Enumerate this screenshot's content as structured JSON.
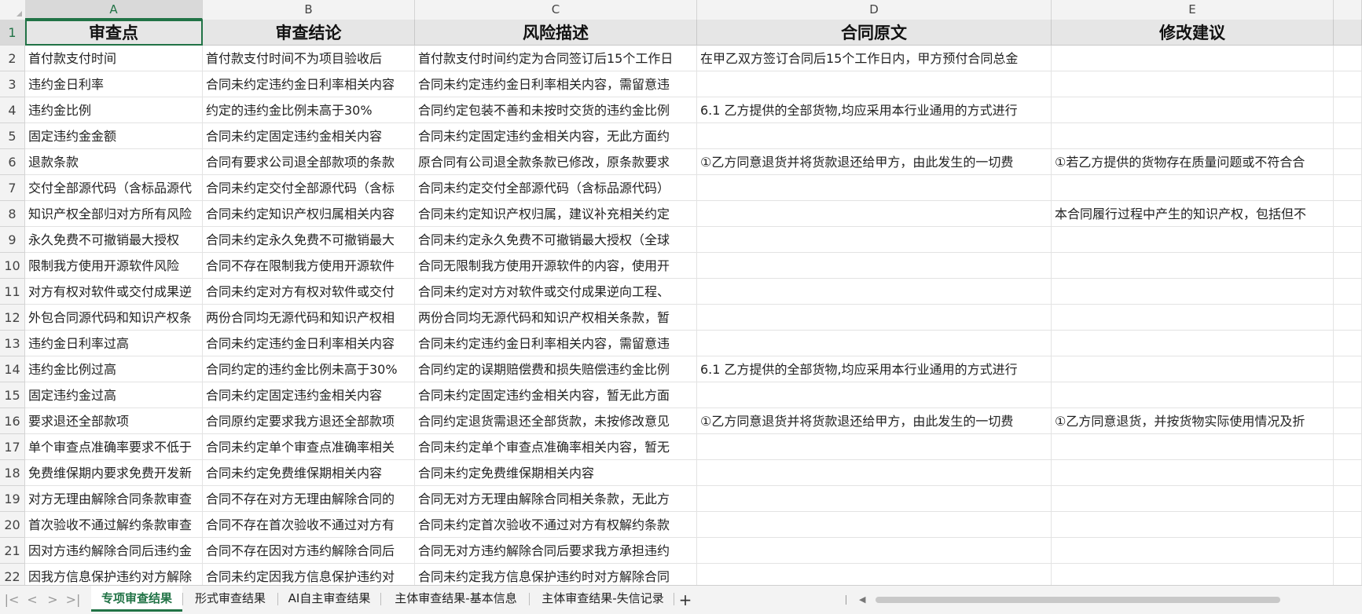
{
  "columns": [
    "A",
    "B",
    "C",
    "D",
    "E"
  ],
  "headers": [
    "审查点",
    "审查结论",
    "风险描述",
    "合同原文",
    "修改建议"
  ],
  "rows": [
    {
      "num": "2",
      "cells": [
        "首付款支付时间",
        "首付款支付时间不为项目验收后",
        "首付款支付时间约定为合同签订后15个工作日",
        "在甲乙双方签订合同后15个工作日内，甲方预付合同总金",
        ""
      ]
    },
    {
      "num": "3",
      "cells": [
        "违约金日利率",
        "合同未约定违约金日利率相关内容",
        "合同未约定违约金日利率相关内容，需留意违",
        "",
        ""
      ]
    },
    {
      "num": "4",
      "cells": [
        "违约金比例",
        "约定的违约金比例未高于30%",
        "合同约定包装不善和未按时交货的违约金比例",
        "6.1    乙方提供的全部货物,均应采用本行业通用的方式进行",
        ""
      ]
    },
    {
      "num": "5",
      "cells": [
        "固定违约金金额",
        "合同未约定固定违约金相关内容",
        "合同未约定固定违约金相关内容，无此方面约",
        "",
        ""
      ]
    },
    {
      "num": "6",
      "cells": [
        "退款条款",
        "合同有要求公司退全部款项的条款",
        "原合同有公司退全款条款已修改，原条款要求",
        "①乙方同意退货并将货款退还给甲方，由此发生的一切费",
        "①若乙方提供的货物存在质量问题或不符合合"
      ]
    },
    {
      "num": "7",
      "cells": [
        "交付全部源代码（含标品源代",
        "合同未约定交付全部源代码（含标",
        "合同未约定交付全部源代码（含标品源代码）",
        "",
        ""
      ]
    },
    {
      "num": "8",
      "cells": [
        "知识产权全部归对方所有风险",
        "合同未约定知识产权归属相关内容",
        "合同未约定知识产权归属，建议补充相关约定",
        "",
        "本合同履行过程中产生的知识产权，包括但不"
      ]
    },
    {
      "num": "9",
      "cells": [
        "永久免费不可撤销最大授权",
        "合同未约定永久免费不可撤销最大",
        "合同未约定永久免费不可撤销最大授权（全球",
        "",
        ""
      ]
    },
    {
      "num": "10",
      "cells": [
        "限制我方使用开源软件风险",
        "合同不存在限制我方使用开源软件",
        "合同无限制我方使用开源软件的内容，使用开",
        "",
        ""
      ]
    },
    {
      "num": "11",
      "cells": [
        "对方有权对软件或交付成果逆",
        "合同未约定对方有权对软件或交付",
        "合同未约定对方对软件或交付成果逆向工程、",
        "",
        ""
      ]
    },
    {
      "num": "12",
      "cells": [
        "外包合同源代码和知识产权条",
        "两份合同均无源代码和知识产权相",
        "两份合同均无源代码和知识产权相关条款，暂",
        "",
        ""
      ]
    },
    {
      "num": "13",
      "cells": [
        "违约金日利率过高",
        "合同未约定违约金日利率相关内容",
        "合同未约定违约金日利率相关内容，需留意违",
        "",
        ""
      ]
    },
    {
      "num": "14",
      "cells": [
        "违约金比例过高",
        "合同约定的违约金比例未高于30%",
        "合同约定的误期赔偿费和损失赔偿违约金比例",
        "6.1    乙方提供的全部货物,均应采用本行业通用的方式进行",
        ""
      ]
    },
    {
      "num": "15",
      "cells": [
        "固定违约金过高",
        "合同未约定固定违约金相关内容",
        "合同未约定固定违约金相关内容，暂无此方面",
        "",
        ""
      ]
    },
    {
      "num": "16",
      "cells": [
        "要求退还全部款项",
        "合同原约定要求我方退还全部款项",
        "合同约定退货需退还全部货款，未按修改意见",
        "①乙方同意退货并将货款退还给甲方，由此发生的一切费",
        "①乙方同意退货，并按货物实际使用情况及折"
      ]
    },
    {
      "num": "17",
      "cells": [
        "单个审查点准确率要求不低于",
        "合同未约定单个审查点准确率相关",
        "合同未约定单个审查点准确率相关内容，暂无",
        "",
        ""
      ]
    },
    {
      "num": "18",
      "cells": [
        "免费维保期内要求免费开发新",
        "合同未约定免费维保期相关内容",
        "合同未约定免费维保期相关内容",
        "",
        ""
      ]
    },
    {
      "num": "19",
      "cells": [
        "对方无理由解除合同条款审查",
        "合同不存在对方无理由解除合同的",
        "合同无对方无理由解除合同相关条款，无此方",
        "",
        ""
      ]
    },
    {
      "num": "20",
      "cells": [
        "首次验收不通过解约条款审查",
        "合同不存在首次验收不通过对方有",
        "合同未约定首次验收不通过对方有权解约条款",
        "",
        ""
      ]
    },
    {
      "num": "21",
      "cells": [
        "因对方违约解除合同后违约金",
        "合同不存在因对方违约解除合同后",
        "合同无对方违约解除合同后要求我方承担违约",
        "",
        ""
      ]
    },
    {
      "num": "22",
      "cells": [
        "因我方信息保护违约对方解除",
        "合同未约定因我方信息保护违约对",
        "合同未约定我方信息保护违约时对方解除合同",
        "",
        ""
      ]
    }
  ],
  "tabs": [
    "专项审查结果",
    "形式审查结果",
    "AI自主审查结果",
    "主体审查结果-基本信息",
    "主体审查结果-失信记录"
  ],
  "active_tab": "专项审查结果",
  "header_row_num": "1",
  "add_tab_label": "+",
  "nav": [
    "|<",
    "<",
    ">",
    ">|"
  ],
  "accent_color": "#217346"
}
